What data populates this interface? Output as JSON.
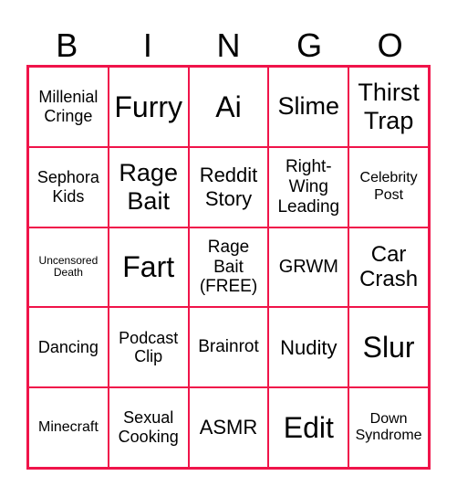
{
  "header": [
    "B",
    "I",
    "N",
    "G",
    "O"
  ],
  "colors": {
    "border": "#f0144a",
    "text": "#000000",
    "background": "#ffffff"
  },
  "cells": [
    "Millenial Cringe",
    "Furry",
    "Ai",
    "Slime",
    "Thirst Trap",
    "Sephora Kids",
    "Rage Bait",
    "Reddit Story",
    "Right-Wing Leading",
    "Celebrity Post",
    "Uncensored Death",
    "Fart",
    "Rage Bait (FREE)",
    "GRWM",
    "Car Crash",
    "Dancing",
    "Podcast Clip",
    "Brainrot",
    "Nudity",
    "Slur",
    "Minecraft",
    "Sexual Cooking",
    "ASMR",
    "Edit",
    "Down Syndrome"
  ]
}
